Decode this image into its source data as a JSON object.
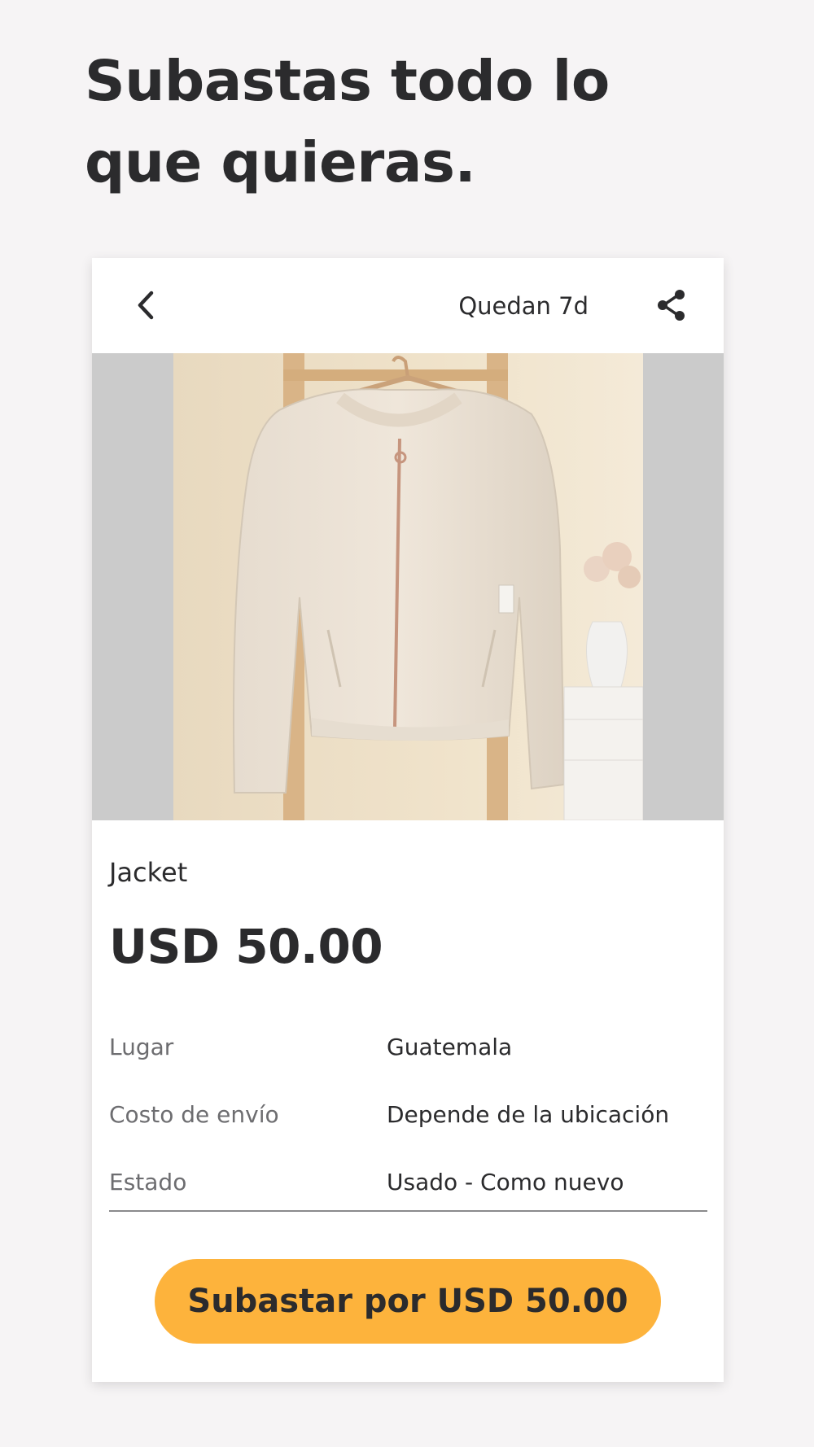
{
  "headline": "Subastas todo lo que quieras.",
  "header": {
    "back_icon": "chevron-left-icon",
    "time_left": "Quedan 7d",
    "share_icon": "share-icon"
  },
  "listing": {
    "title": "Jacket",
    "price": "USD 50.00",
    "details": [
      {
        "label": "Lugar",
        "value": "Guatemala"
      },
      {
        "label": "Costo de envío",
        "value": "Depende de la ubicación"
      },
      {
        "label": "Estado",
        "value": "Usado - Como nuevo"
      }
    ]
  },
  "cta": {
    "label": "Subastar por USD 50.00"
  },
  "colors": {
    "background": "#f6f4f5",
    "text": "#2b2b2d",
    "muted_text": "#6d6d70",
    "accent": "#fdb33c",
    "photo_letterbox": "#cbcbcb"
  }
}
